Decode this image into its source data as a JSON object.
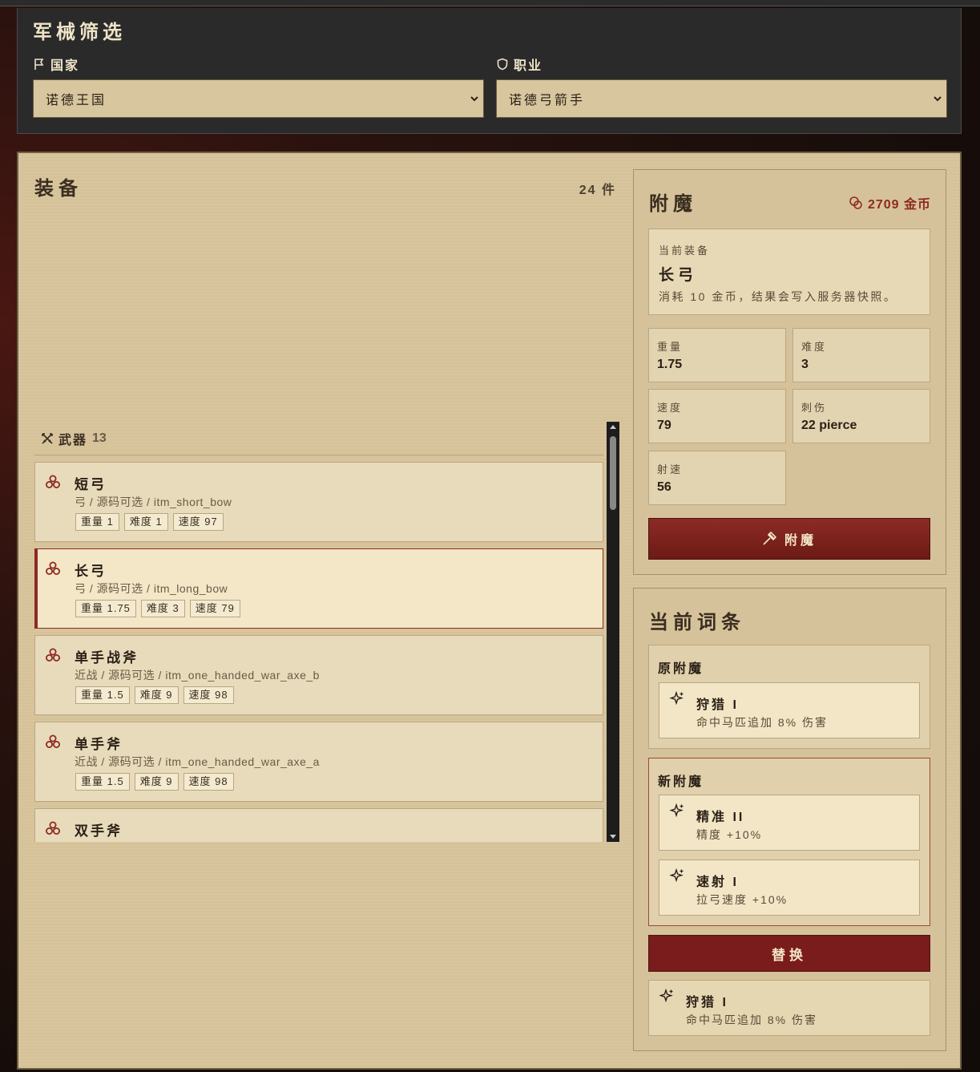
{
  "filter": {
    "title": "军械筛选",
    "nation_label": "国家",
    "nation_value": "诺德王国",
    "class_label": "职业",
    "class_value": "诺德弓箭手"
  },
  "equipment": {
    "title": "装备",
    "count": "24 件",
    "group": {
      "label": "武器",
      "count": "13"
    },
    "items": [
      {
        "name": "短弓",
        "sub": "弓 / 源码可选 / itm_short_bow",
        "tags": [
          "重量 1",
          "难度 1",
          "速度 97"
        ],
        "selected": false
      },
      {
        "name": "长弓",
        "sub": "弓 / 源码可选 / itm_long_bow",
        "tags": [
          "重量 1.75",
          "难度 3",
          "速度 79"
        ],
        "selected": true
      },
      {
        "name": "单手战斧",
        "sub": "近战 / 源码可选 / itm_one_handed_war_axe_b",
        "tags": [
          "重量 1.5",
          "难度 9",
          "速度 98"
        ],
        "selected": false
      },
      {
        "name": "单手斧",
        "sub": "近战 / 源码可选 / itm_one_handed_war_axe_a",
        "tags": [
          "重量 1.5",
          "难度 9",
          "速度 98"
        ],
        "selected": false
      },
      {
        "name": "双手斧",
        "sub": "",
        "tags": [],
        "selected": false
      }
    ]
  },
  "enchant": {
    "title": "附魔",
    "gold": "2709 金币",
    "current_label": "当前装备",
    "current_name": "长弓",
    "current_note": "消耗 10 金币，结果会写入服务器快照。",
    "stats": [
      {
        "label": "重量",
        "value": "1.75"
      },
      {
        "label": "难度",
        "value": "3"
      },
      {
        "label": "速度",
        "value": "79"
      },
      {
        "label": "刺伤",
        "value": "22 pierce"
      },
      {
        "label": "射速",
        "value": "56"
      }
    ],
    "button": "附魔"
  },
  "affixes": {
    "title": "当前词条",
    "original_label": "原附魔",
    "original": [
      {
        "name": "狩猎 I",
        "desc": "命中马匹追加 8% 伤害"
      }
    ],
    "new_label": "新附魔",
    "new": [
      {
        "name": "精准 II",
        "desc": "精度 +10%"
      },
      {
        "name": "速射 I",
        "desc": "拉弓速度 +10%"
      }
    ],
    "replace_button": "替换",
    "current": {
      "name": "狩猎 I",
      "desc": "命中马匹追加 8% 伤害"
    }
  },
  "colors": {
    "accent": "#8e2a22",
    "parchment": "#d8c59d",
    "dark_panel": "#2a2a2a"
  },
  "icons": [
    "flag-icon",
    "shield-icon",
    "crossed-swords-icon",
    "item-emblem-icon",
    "coins-icon",
    "hammer-icon",
    "sparkle-icon"
  ]
}
